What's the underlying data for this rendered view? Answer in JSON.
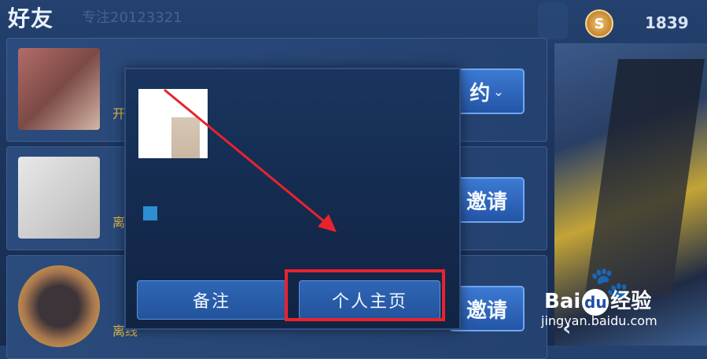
{
  "header": {
    "title": "好友",
    "subtitle": "专注20123321"
  },
  "topbar": {
    "currency_icon_text": "S",
    "coin_count": "1839"
  },
  "friends": [
    {
      "name": "",
      "status": "开",
      "action_label": "约",
      "action_has_dropdown": true
    },
    {
      "name": "",
      "status": "离线",
      "action_label": "邀请"
    },
    {
      "name": "",
      "status": "离线",
      "action_label": "邀请"
    }
  ],
  "popup": {
    "note_button": "备注",
    "profile_button": "个人主页"
  },
  "watermark": {
    "brand_left": "Bai",
    "brand_mid": "du",
    "brand_right": "经验",
    "site": "jingyan.baidu.com"
  },
  "colors": {
    "highlight": "#e8232c",
    "button": "#2f66b6",
    "accent": "#e0b94a"
  },
  "icons": {
    "back": "chevron-left-icon",
    "paw": "baidu-paw-icon",
    "currency": "coin-icon"
  }
}
